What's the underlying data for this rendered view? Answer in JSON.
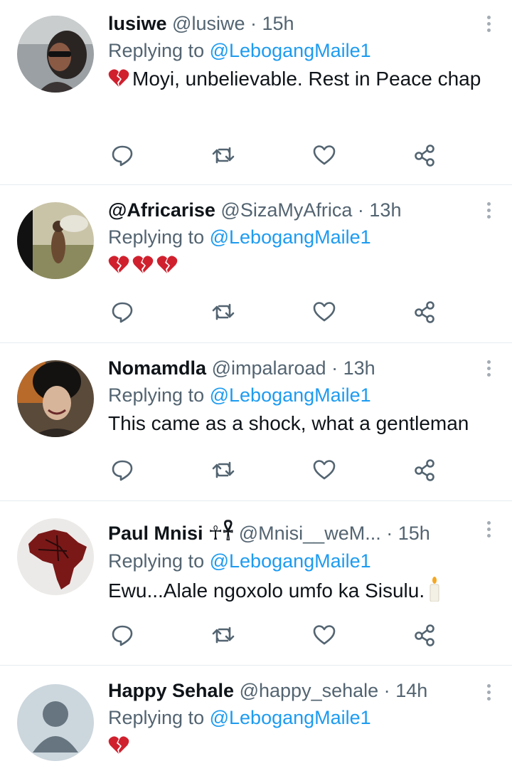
{
  "tweets": [
    {
      "name": "lusiwe",
      "handle": "@lusiwe",
      "dot": "·",
      "time": "15h",
      "replying_label": "Replying to",
      "mention": "@LebogangMaile1",
      "text": "Moyi, unbelievable. Rest in Peace chap",
      "emoji_prefix": "broken-heart",
      "avatar": "woman-in-car"
    },
    {
      "name": "@Africarise",
      "handle": "@SizaMyAfrica",
      "dot": "·",
      "time": "13h",
      "replying_label": "Replying to",
      "mention": "@LebogangMaile1",
      "text": "",
      "emoji_prefix": "broken-heart ×3",
      "avatar": "child-landscape"
    },
    {
      "name": "Nomamdla",
      "handle": "@impalaroad",
      "dot": "·",
      "time": "13h",
      "replying_label": "Replying to",
      "mention": "@LebogangMaile1",
      "text": "This came as a shock, what a gentleman",
      "avatar": "woman-portrait"
    },
    {
      "name": "Paul Mnisi",
      "name_glyphs": "☥𓋹",
      "handle": "@Mnisi__weM...",
      "dot": "·",
      "time": "15h",
      "replying_label": "Replying to",
      "mention": "@LebogangMaile1",
      "text": "Ewu...Alale ngoxolo umfo ka Sisulu.",
      "emoji_suffix": "candle",
      "avatar": "africa-map"
    },
    {
      "name": "Happy Sehale",
      "handle": "@happy_sehale",
      "dot": "·",
      "time": "14h",
      "replying_label": "Replying to",
      "mention": "@LebogangMaile1",
      "text": "",
      "emoji_prefix": "broken-heart",
      "avatar": "default-avatar"
    }
  ],
  "colors": {
    "name": "#0f1419",
    "secondary": "#536471",
    "mention": "#1d9bf0",
    "divider": "#e6ecf0",
    "broken_heart": "#d0202e"
  },
  "icons": [
    "reply-icon",
    "retweet-icon",
    "like-icon",
    "share-icon",
    "more-icon"
  ]
}
